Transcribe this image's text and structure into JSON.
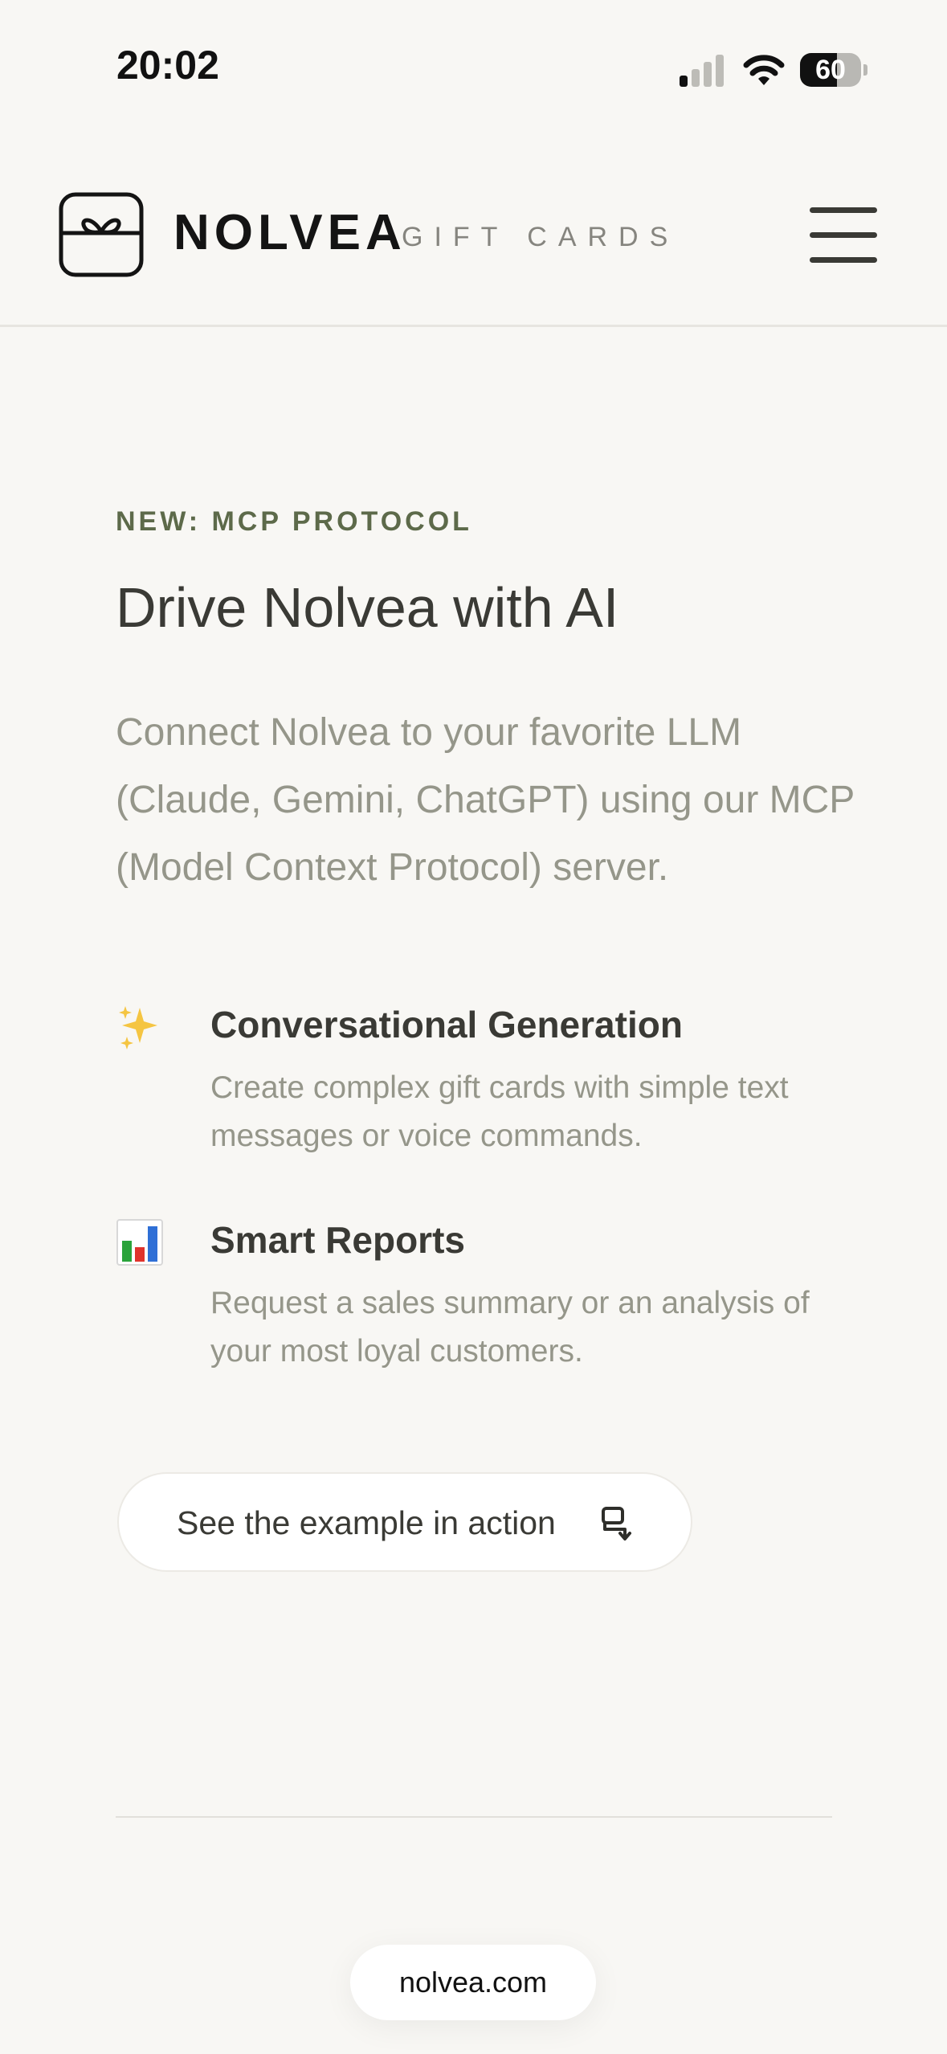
{
  "status_bar": {
    "time": "20:02",
    "battery_level": "60",
    "battery_fraction": 0.6,
    "icons": [
      "signal-icon",
      "wifi-icon",
      "battery-icon"
    ]
  },
  "header": {
    "brand_name": "NOLVEA",
    "brand_sub": "GIFT CARDS",
    "logo_icon": "gift-box-icon",
    "menu_icon": "hamburger-menu-icon"
  },
  "main": {
    "eyebrow": "NEW: MCP PROTOCOL",
    "title": "Drive Nolvea with AI",
    "intro": "Connect Nolvea to your favorite LLM (Claude, Gemini, ChatGPT) using our MCP (Model Context Protocol) server.",
    "features": [
      {
        "icon": "sparkles-icon",
        "title": "Conversational Generation",
        "description": "Create complex gift cards with simple text messages or voice commands."
      },
      {
        "icon": "bar-chart-icon",
        "title": "Smart Reports",
        "description": "Request a sales summary or an analysis of your most loyal customers."
      }
    ],
    "cta": {
      "label": "See the example in action",
      "icon": "chat-arrow-icon"
    }
  },
  "browser": {
    "url": "nolvea.com"
  },
  "colors": {
    "background": "#f8f7f4",
    "eyebrow": "#5d6a4a",
    "text_dark": "#3a3a35",
    "text_muted": "#95968a"
  }
}
